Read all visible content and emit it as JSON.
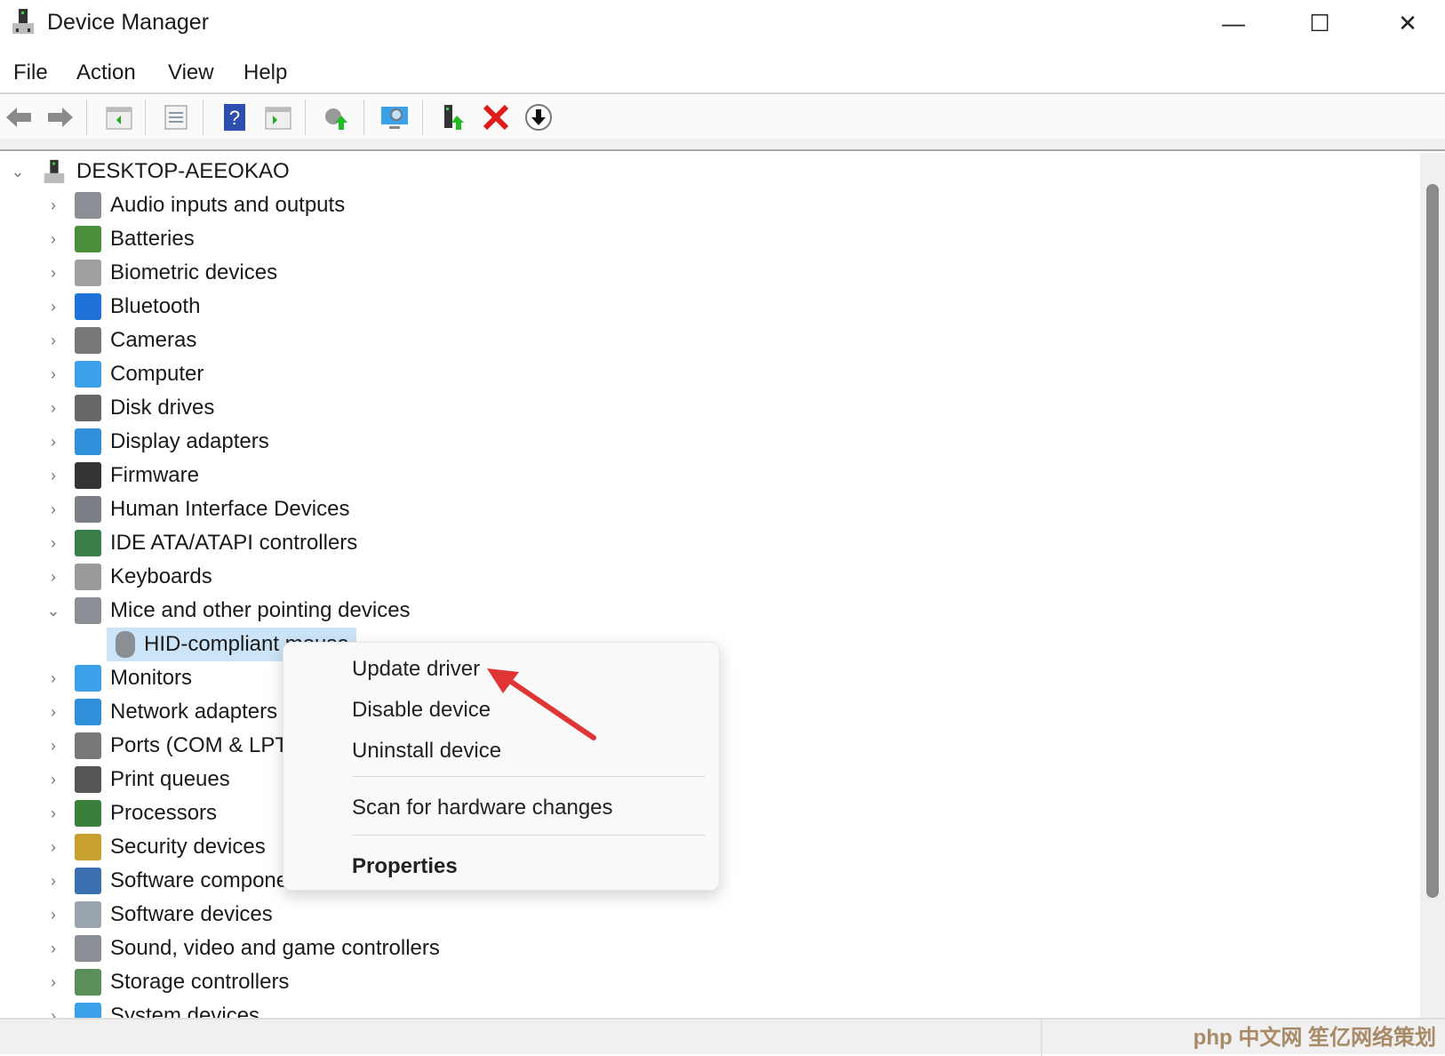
{
  "window": {
    "title": "Device Manager",
    "minimize": "—",
    "maximize": "☐",
    "close": "✕"
  },
  "menu": [
    "File",
    "Action",
    "View",
    "Help"
  ],
  "toolbar": [
    "back-icon",
    "forward-icon",
    "show-hide-console-tree-icon",
    "properties-icon",
    "help-icon",
    "action-pane-icon",
    "update-driver-icon",
    "scan-hardware-icon",
    "enable-device-icon",
    "uninstall-device-icon",
    "disable-device-icon"
  ],
  "tree": {
    "root": "DESKTOP-AEEOKAO",
    "items": [
      {
        "label": "Audio inputs and outputs",
        "color": "#8a8f96"
      },
      {
        "label": "Batteries",
        "color": "#4a8f3a"
      },
      {
        "label": "Biometric devices",
        "color": "#a0a0a0"
      },
      {
        "label": "Bluetooth",
        "color": "#1e72d8"
      },
      {
        "label": "Cameras",
        "color": "#777777"
      },
      {
        "label": "Computer",
        "color": "#3aa0e8"
      },
      {
        "label": "Disk drives",
        "color": "#666666"
      },
      {
        "label": "Display adapters",
        "color": "#2f8fd8"
      },
      {
        "label": "Firmware",
        "color": "#333333"
      },
      {
        "label": "Human Interface Devices",
        "color": "#7a7f86"
      },
      {
        "label": "IDE ATA/ATAPI controllers",
        "color": "#3a7f4a"
      },
      {
        "label": "Keyboards",
        "color": "#9a9a9a"
      },
      {
        "label": "Mice and other pointing devices",
        "color": "#8a8f96",
        "expanded": true
      },
      {
        "label": "HID-compliant mouse",
        "color": "#8a8f96",
        "child": true,
        "selected": true
      },
      {
        "label": "Monitors",
        "color": "#3aa0e8"
      },
      {
        "label": "Network adapters",
        "color": "#2f8fd8"
      },
      {
        "label": "Ports (COM & LPT)",
        "color": "#777777"
      },
      {
        "label": "Print queues",
        "color": "#555555"
      },
      {
        "label": "Processors",
        "color": "#3a7f3a"
      },
      {
        "label": "Security devices",
        "color": "#c8a030"
      },
      {
        "label": "Software components",
        "color": "#3a6fb0"
      },
      {
        "label": "Software devices",
        "color": "#9aa4ae"
      },
      {
        "label": "Sound, video and game controllers",
        "color": "#8a8f96"
      },
      {
        "label": "Storage controllers",
        "color": "#5a8f5a"
      },
      {
        "label": "System devices",
        "color": "#3aa0e8"
      }
    ]
  },
  "context_menu": {
    "update": "Update driver",
    "disable": "Disable device",
    "uninstall": "Uninstall device",
    "scan": "Scan for hardware changes",
    "properties": "Properties"
  },
  "watermark": "php 中文网 笙亿网络策划"
}
